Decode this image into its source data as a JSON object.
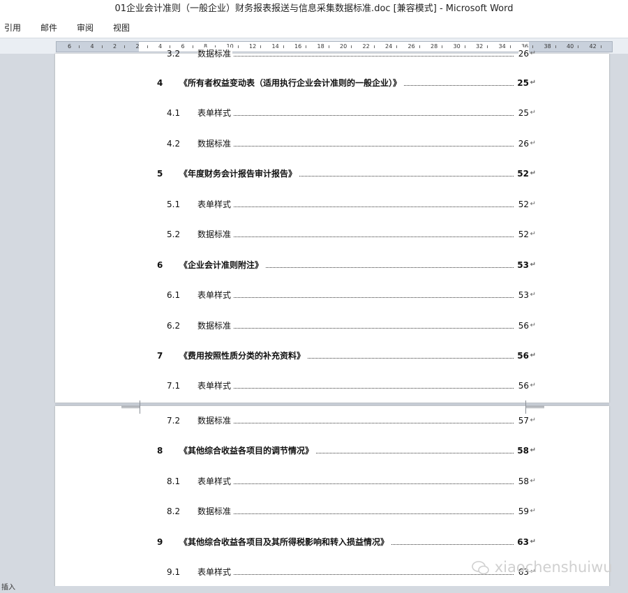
{
  "window": {
    "title": "01企业会计准则（一般企业）财务报表报送与信息采集数据标准.doc [兼容模式] - Microsoft Word"
  },
  "menu": {
    "items": [
      "引用",
      "邮件",
      "审阅",
      "视图"
    ]
  },
  "ruler": {
    "labels": [
      "6",
      "4",
      "2",
      "2",
      "4",
      "6",
      "8",
      "10",
      "12",
      "14",
      "16",
      "18",
      "20",
      "22",
      "24",
      "26",
      "28",
      "30",
      "32",
      "34",
      "36",
      "38",
      "40",
      "42"
    ]
  },
  "toc": {
    "top_partial": {
      "number": "3.2",
      "title": "数据标准",
      "page": "26"
    },
    "page1": [
      {
        "number": "4",
        "title": "《所有者权益变动表（适用执行企业会计准则的一般企业）》",
        "page": "25",
        "level": 1
      },
      {
        "number": "4.1",
        "title": "表单样式",
        "page": "25",
        "level": 2
      },
      {
        "number": "4.2",
        "title": "数据标准",
        "page": "26",
        "level": 2
      },
      {
        "number": "5",
        "title": "《年度财务会计报告审计报告》",
        "page": "52",
        "level": 1
      },
      {
        "number": "5.1",
        "title": "表单样式",
        "page": "52",
        "level": 2
      },
      {
        "number": "5.2",
        "title": "数据标准",
        "page": "52",
        "level": 2
      },
      {
        "number": "6",
        "title": "《企业会计准则附注》",
        "page": "53",
        "level": 1
      },
      {
        "number": "6.1",
        "title": "表单样式",
        "page": "53",
        "level": 2
      },
      {
        "number": "6.2",
        "title": "数据标准",
        "page": "56",
        "level": 2
      },
      {
        "number": "7",
        "title": "《费用按照性质分类的补充资料》",
        "page": "56",
        "level": 1
      },
      {
        "number": "7.1",
        "title": "表单样式",
        "page": "56",
        "level": 2
      }
    ],
    "page2": [
      {
        "number": "7.2",
        "title": "数据标准",
        "page": "57",
        "level": 2
      },
      {
        "number": "8",
        "title": "《其他综合收益各项目的调节情况》",
        "page": "58",
        "level": 1
      },
      {
        "number": "8.1",
        "title": "表单样式",
        "page": "58",
        "level": 2
      },
      {
        "number": "8.2",
        "title": "数据标准",
        "page": "59",
        "level": 2
      },
      {
        "number": "9",
        "title": "《其他综合收益各项目及其所得税影响和转入损益情况》",
        "page": "63",
        "level": 1
      },
      {
        "number": "9.1",
        "title": "表单样式",
        "page": "63",
        "level": 2
      }
    ]
  },
  "statusbar": {
    "mode": "插入"
  },
  "watermark": {
    "text": "xiaochenshuiwu"
  }
}
